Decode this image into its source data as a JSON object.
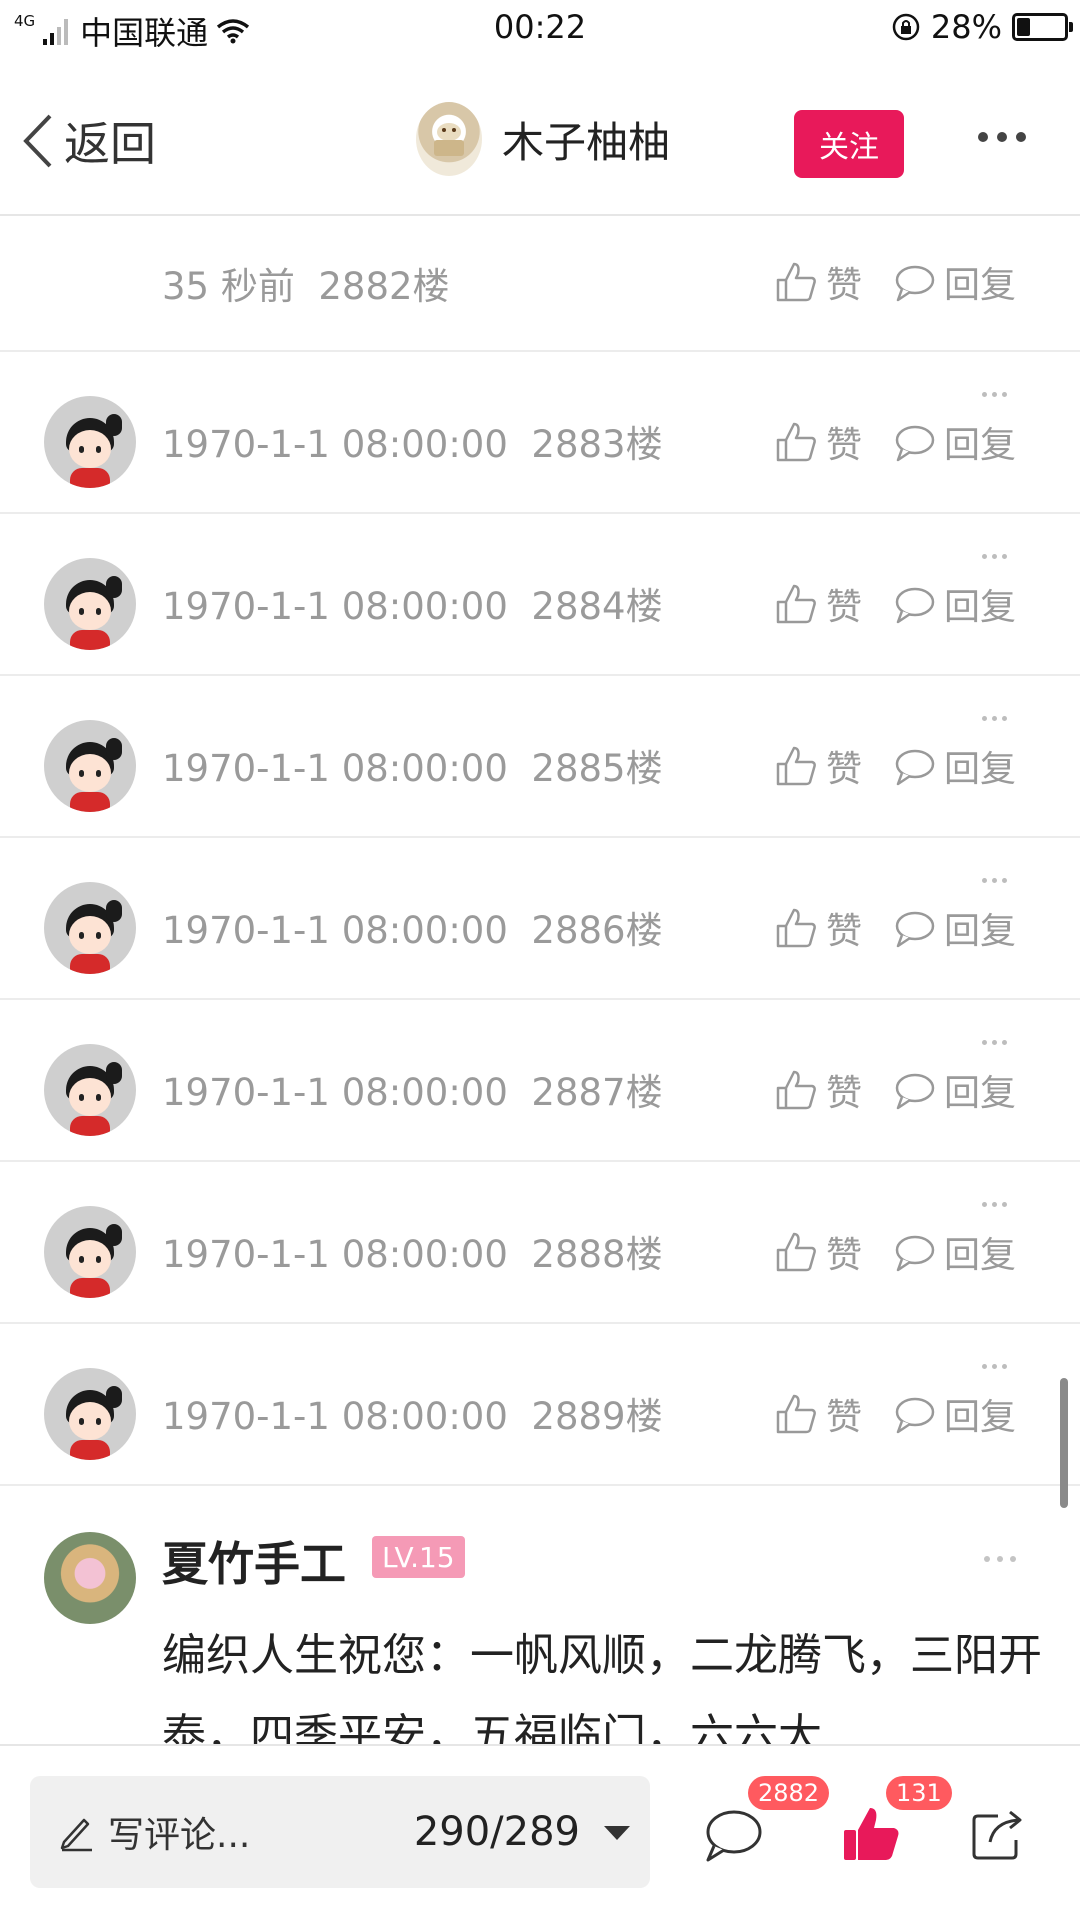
{
  "status_bar": {
    "network": "4G",
    "carrier": "中国联通",
    "time": "00:22",
    "battery": "28%",
    "battery_level": 0.28
  },
  "header": {
    "back_label": "返回",
    "author_name": "木子柚柚",
    "follow_label": "关注"
  },
  "replies": [
    {
      "meta": "35 秒前  2882楼",
      "like_label": "赞",
      "reply_label": "回复",
      "has_avatar": false
    },
    {
      "meta": "1970-1-1 08:00:00  2883楼",
      "like_label": "赞",
      "reply_label": "回复",
      "has_avatar": true
    },
    {
      "meta": "1970-1-1 08:00:00  2884楼",
      "like_label": "赞",
      "reply_label": "回复",
      "has_avatar": true
    },
    {
      "meta": "1970-1-1 08:00:00  2885楼",
      "like_label": "赞",
      "reply_label": "回复",
      "has_avatar": true
    },
    {
      "meta": "1970-1-1 08:00:00  2886楼",
      "like_label": "赞",
      "reply_label": "回复",
      "has_avatar": true
    },
    {
      "meta": "1970-1-1 08:00:00  2887楼",
      "like_label": "赞",
      "reply_label": "回复",
      "has_avatar": true
    },
    {
      "meta": "1970-1-1 08:00:00  2888楼",
      "like_label": "赞",
      "reply_label": "回复",
      "has_avatar": true
    },
    {
      "meta": "1970-1-1 08:00:00  2889楼",
      "like_label": "赞",
      "reply_label": "回复",
      "has_avatar": true
    }
  ],
  "comment": {
    "user_name": "夏竹手工",
    "level": "LV.15",
    "text": "编织人生祝您：一帆风顺，二龙腾飞，三阳开泰，四季平安，五福临门，六六大"
  },
  "bottom_bar": {
    "placeholder": "写评论...",
    "counter": "290/289",
    "comments_badge": "2882",
    "likes_badge": "131"
  },
  "colors": {
    "accent": "#e8195a",
    "badge": "#ff5a5f",
    "level": "#f59ab6",
    "meta_text": "#9a9a9a"
  },
  "icons": [
    "back-chevron-icon",
    "like-thumb-icon",
    "reply-bubble-icon",
    "pencil-icon",
    "dropdown-caret-icon",
    "comment-bubble-icon",
    "thumbs-up-filled-icon",
    "share-icon",
    "more-dots-icon"
  ]
}
